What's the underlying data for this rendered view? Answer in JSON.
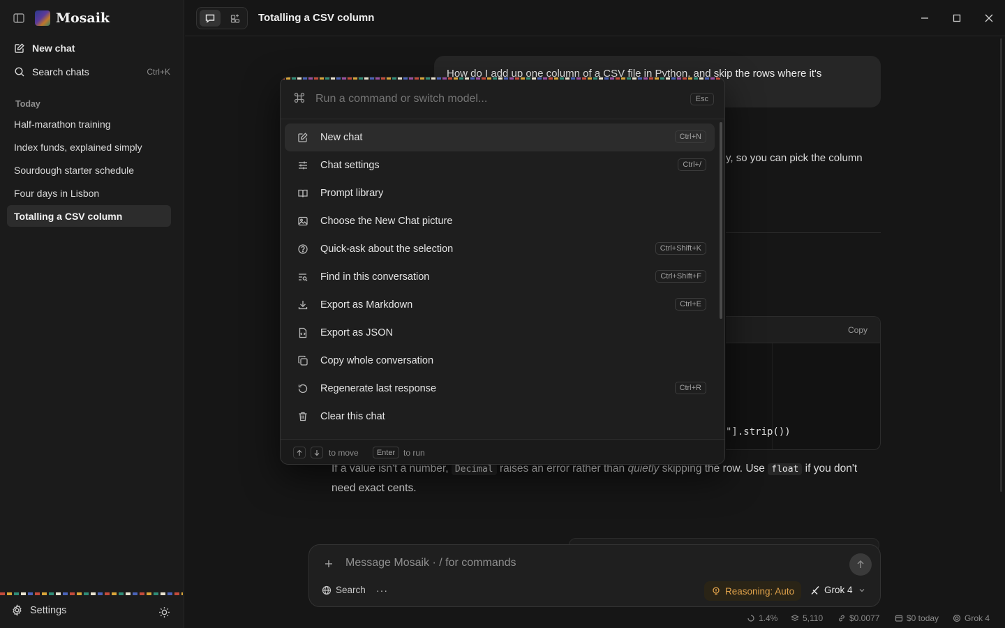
{
  "app": {
    "name": "Mosaik"
  },
  "sidebar": {
    "new_chat": "New chat",
    "search_chats": "Search chats",
    "search_shortcut": "Ctrl+K",
    "section_today": "Today",
    "chats": [
      {
        "label": "Half-marathon training"
      },
      {
        "label": "Index funds, explained simply"
      },
      {
        "label": "Sourdough starter schedule"
      },
      {
        "label": "Four days in Lisbon"
      },
      {
        "label": "Totalling a CSV column",
        "active": true
      }
    ],
    "settings": "Settings"
  },
  "header": {
    "title": "Totalling a CSV column"
  },
  "conversation": {
    "user_message": "How do I add up one column of a CSV file in Python, and skip the rows where it's",
    "assistant_peek": "y, so you can pick the column",
    "code_copy": "Copy",
    "code_fragment": "\"].strip())",
    "answer_part1": "If a value isn't a number, ",
    "answer_code1": "Decimal",
    "answer_part2": " raises an error rather than ",
    "answer_em": "quietly",
    "answer_part3": " skipping the row. Use ",
    "answer_code2": "float",
    "answer_part4": " if you don't need exact cents."
  },
  "composer": {
    "placeholder": "Message Mosaik  ·  / for commands",
    "search": "Search",
    "more": "···",
    "reasoning": "Reasoning: Auto",
    "model": "Grok 4"
  },
  "status_bar": {
    "context": "1.4%",
    "tokens": "5,110",
    "cost": "$0.0077",
    "today": "$0 today",
    "model": "Grok 4"
  },
  "palette": {
    "placeholder": "Run a command or switch model...",
    "esc": "Esc",
    "items": [
      {
        "label": "New chat",
        "shortcut": "Ctrl+N",
        "icon": "edit-icon"
      },
      {
        "label": "Chat settings",
        "shortcut": "Ctrl+/",
        "icon": "sliders-icon"
      },
      {
        "label": "Prompt library",
        "shortcut": "",
        "icon": "book-icon"
      },
      {
        "label": "Choose the New Chat picture",
        "shortcut": "",
        "icon": "image-icon"
      },
      {
        "label": "Quick-ask about the selection",
        "shortcut": "Ctrl+Shift+K",
        "icon": "question-icon"
      },
      {
        "label": "Find in this conversation",
        "shortcut": "Ctrl+Shift+F",
        "icon": "find-list-icon"
      },
      {
        "label": "Export as Markdown",
        "shortcut": "Ctrl+E",
        "icon": "download-icon"
      },
      {
        "label": "Export as JSON",
        "shortcut": "",
        "icon": "file-code-icon"
      },
      {
        "label": "Copy whole conversation",
        "shortcut": "",
        "icon": "copy-icon"
      },
      {
        "label": "Regenerate last response",
        "shortcut": "Ctrl+R",
        "icon": "refresh-icon"
      },
      {
        "label": "Clear this chat",
        "shortcut": "",
        "icon": "trash-icon"
      }
    ],
    "footer_move": "to move",
    "footer_enter_key": "Enter",
    "footer_run": "to run"
  },
  "colors": {
    "accent_reasoning": "#e0a24a",
    "background": "#161616",
    "panel": "#1e1e1e"
  }
}
